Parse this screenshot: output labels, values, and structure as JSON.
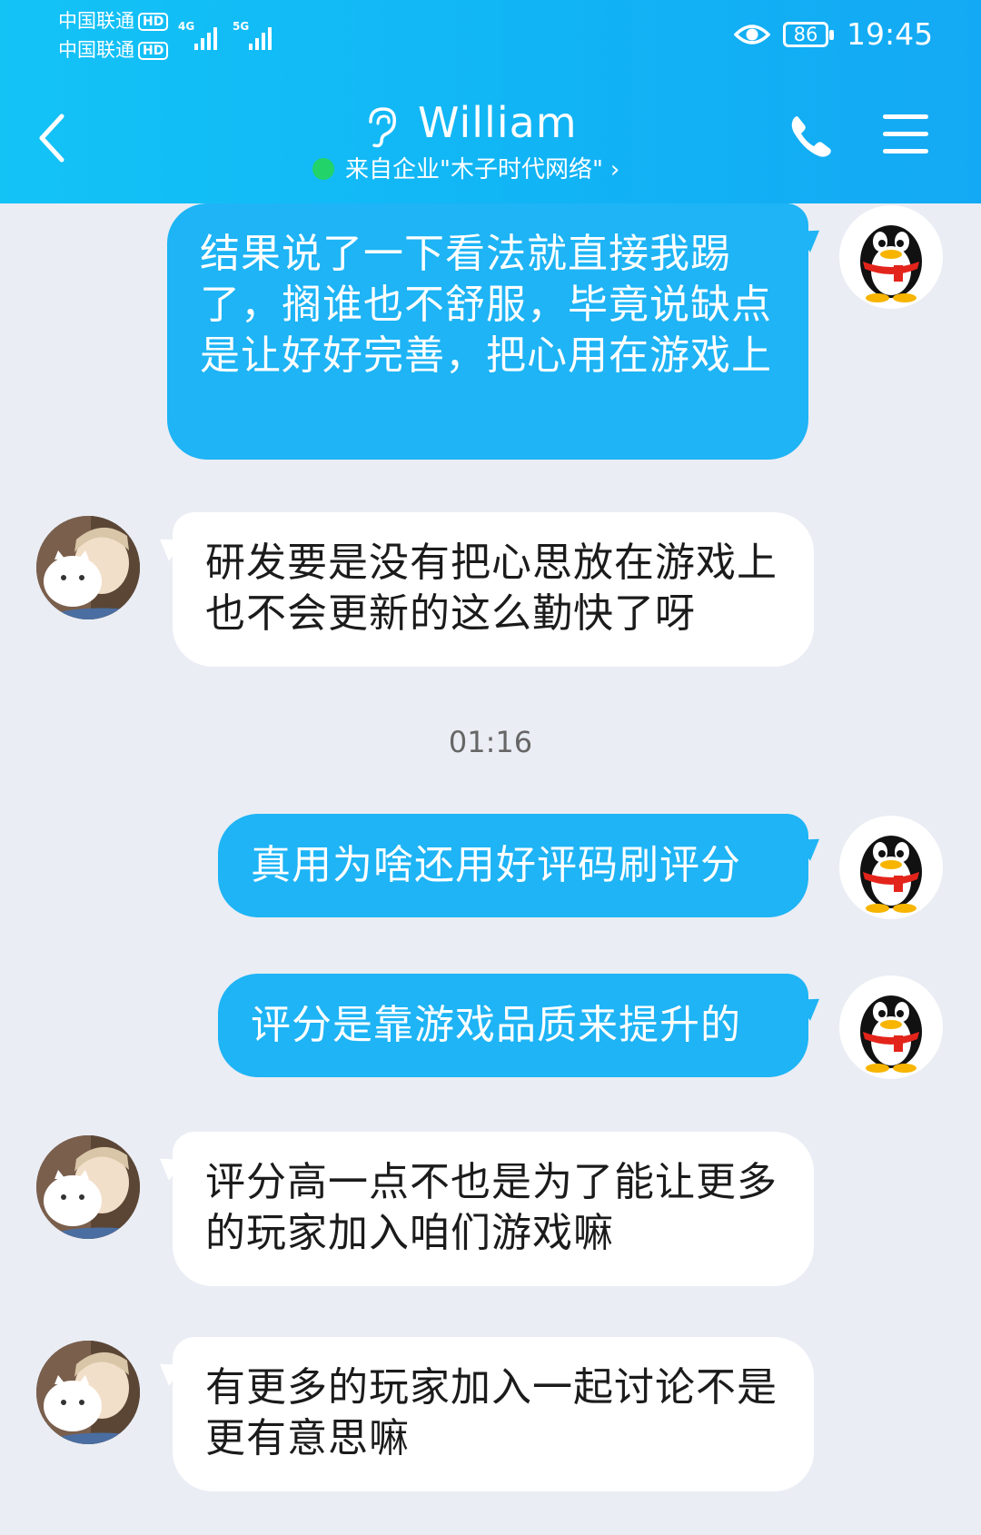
{
  "status_bar": {
    "carrier_1": "中国联通",
    "carrier_2": "中国联通",
    "hd_label": "HD",
    "network_1": "4G",
    "network_2": "5G",
    "battery": "86",
    "time": "19:45"
  },
  "header": {
    "contact_name": "William",
    "subtitle": "来自企业\"木子时代网络\""
  },
  "messages": [
    {
      "side": "out",
      "text": "结果说了一下看法就直接我踢了，搁谁也不舒服，毕竟说缺点是让好好完善，把心用在游戏上"
    },
    {
      "side": "in",
      "text": "研发要是没有把心思放在游戏上也不会更新的这么勤快了呀"
    },
    {
      "timestamp": "01:16"
    },
    {
      "side": "out",
      "text": "真用为啥还用好评码刷评分"
    },
    {
      "side": "out",
      "text": "评分是靠游戏品质来提升的"
    },
    {
      "side": "in",
      "text": "评分高一点不也是为了能让更多的玩家加入咱们游戏嘛"
    },
    {
      "side": "in",
      "text": "有更多的玩家加入一起讨论不是更有意思嘛"
    }
  ],
  "colors": {
    "header": "#13b8f5",
    "outgoing_bubble": "#1eb4f5",
    "incoming_bubble": "#ffffff",
    "background": "#eaedf4",
    "online_dot": "#22d36a"
  }
}
